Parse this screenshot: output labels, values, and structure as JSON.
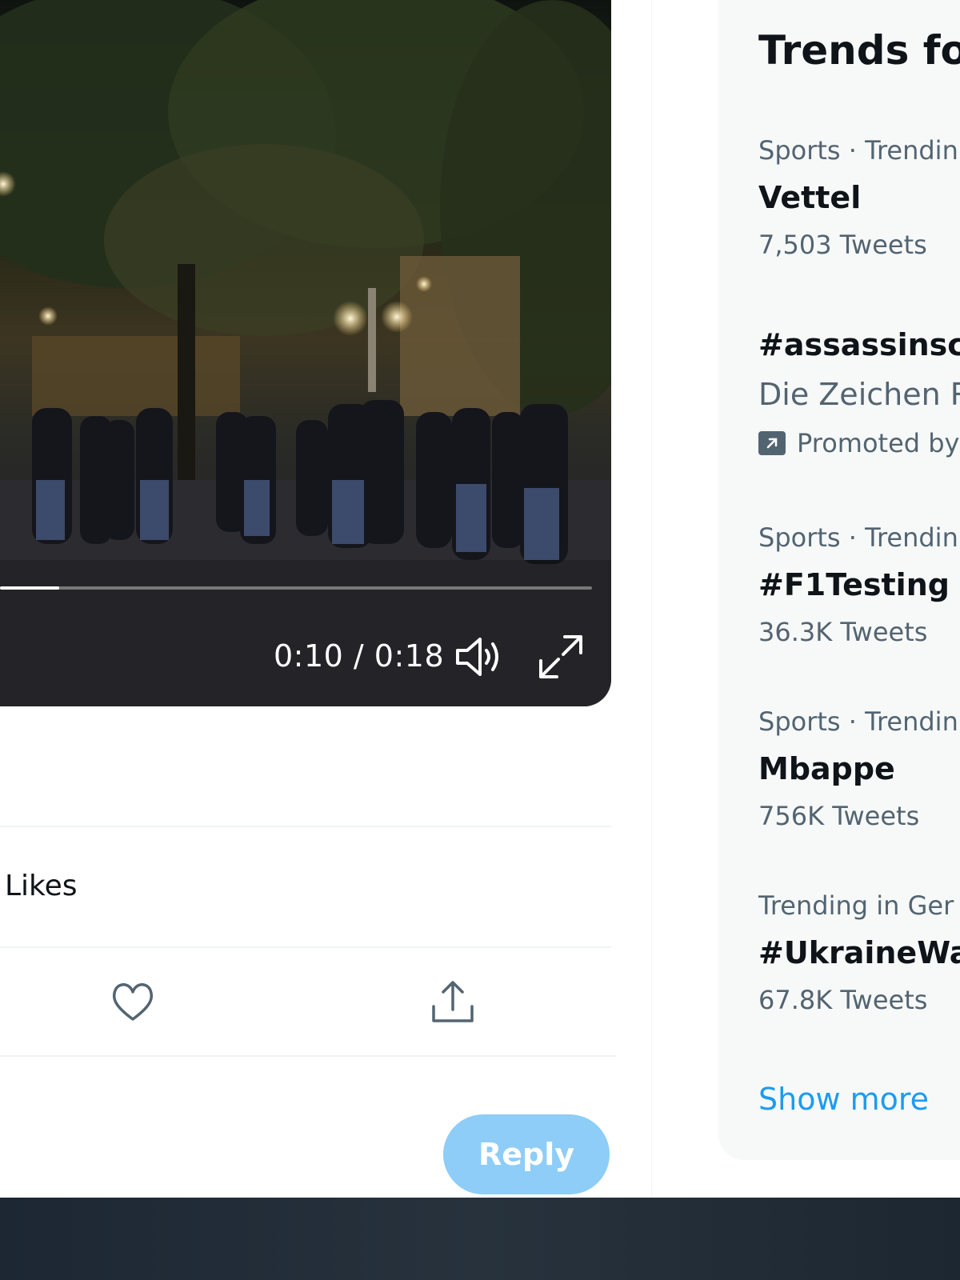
{
  "video": {
    "time_label": "0:10 / 0:18",
    "progress_fraction": 0.1
  },
  "engagement": {
    "likes_label": "Likes"
  },
  "reply": {
    "button_label": "Reply",
    "button_color": "#8ecdf7"
  },
  "trends": {
    "title": "Trends fo",
    "items": [
      {
        "meta": "Sports · Trendin",
        "name": "Vettel",
        "count": "7,503 Tweets"
      },
      {
        "name": "#assassinscre",
        "description": "Die Zeichen R",
        "promoted": "Promoted by"
      },
      {
        "meta": "Sports · Trendin",
        "name": "#F1Testing",
        "count": "36.3K Tweets"
      },
      {
        "meta": "Sports · Trendin",
        "name": "Mbappe",
        "count": "756K Tweets"
      },
      {
        "meta": "Trending in Ger",
        "name": "#UkraineWar",
        "count": "67.8K Tweets"
      }
    ],
    "show_more": "Show more",
    "link_color": "#1d9bf0"
  },
  "icons": [
    "volume-icon",
    "fullscreen-icon",
    "heart-icon",
    "share-icon",
    "promoted-icon"
  ]
}
